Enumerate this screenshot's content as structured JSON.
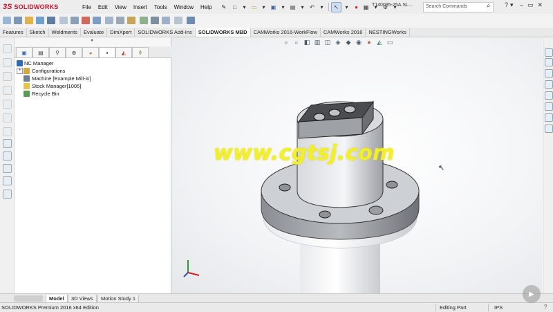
{
  "app": {
    "logo_mark": "3S",
    "logo_text": "SOLIDWORKS",
    "document_name": "T140095-25A.SL..."
  },
  "menu": [
    "File",
    "Edit",
    "View",
    "Insert",
    "Tools",
    "Window",
    "Help"
  ],
  "search": {
    "placeholder": "Search Commands"
  },
  "command_tabs": [
    {
      "label": "Features",
      "active": false
    },
    {
      "label": "Sketch",
      "active": false
    },
    {
      "label": "Weldments",
      "active": false
    },
    {
      "label": "Evaluate",
      "active": false
    },
    {
      "label": "DimXpert",
      "active": false
    },
    {
      "label": "SOLIDWORKS Add-Ins",
      "active": false
    },
    {
      "label": "SOLIDWORKS MBD",
      "active": true
    },
    {
      "label": "CAMWorks 2016-WorkFlow",
      "active": false
    },
    {
      "label": "CAMWorks 2016",
      "active": false
    },
    {
      "label": "NESTINGWorks",
      "active": false
    }
  ],
  "tree": {
    "root": "NC Manager",
    "items": [
      {
        "label": "Configurations",
        "expandable": true
      },
      {
        "label": "Machine [Example Mill-in]",
        "expandable": false
      },
      {
        "label": "Stock Manager[1005]",
        "expandable": false
      },
      {
        "label": "Recycle Bin",
        "expandable": false
      }
    ]
  },
  "graphics": {
    "watermark": "www.cgtsj.com"
  },
  "bottom_tabs": [
    {
      "label": "Model",
      "active": true
    },
    {
      "label": "3D Views",
      "active": false
    },
    {
      "label": "Motion Study 1",
      "active": false
    }
  ],
  "status": {
    "edition": "SOLIDWORKS Premium 2016 x64 Edition",
    "mode": "Editing Part",
    "units": "IPS",
    "help": "?"
  },
  "colors": {
    "brand": "#c8102e",
    "watermark": "#f3ef2a",
    "accent": "#2a6fbf"
  }
}
